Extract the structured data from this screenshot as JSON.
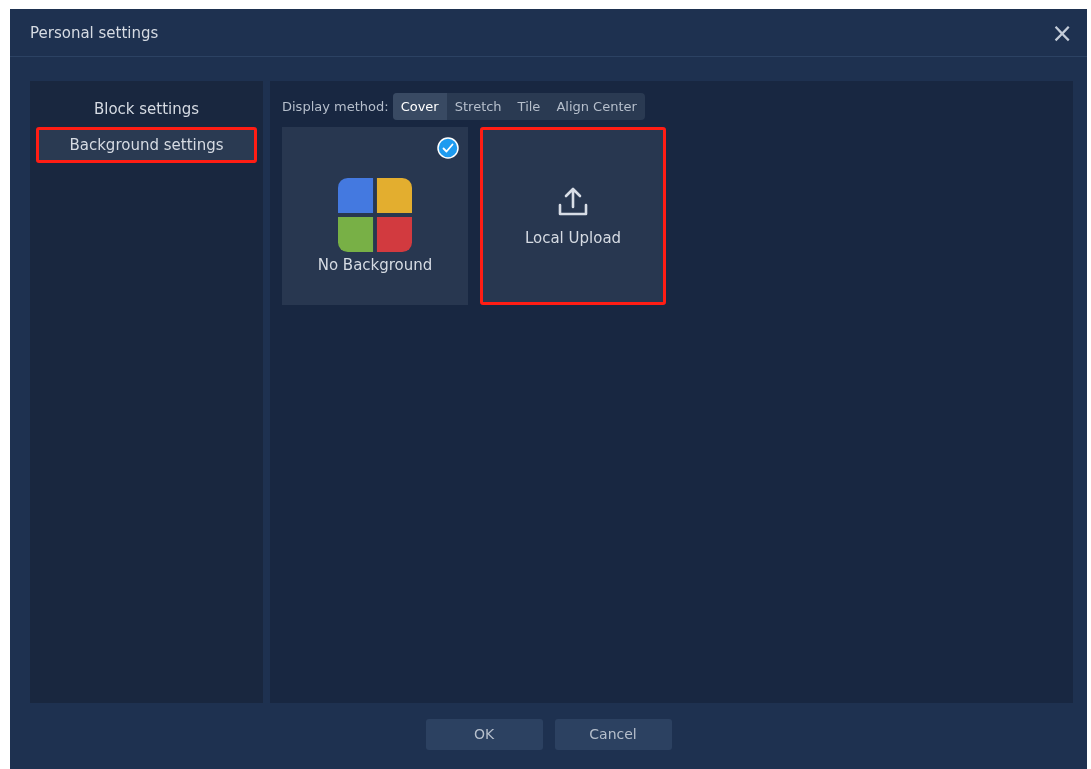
{
  "window": {
    "title": "Personal settings",
    "close": "×"
  },
  "sidebar": {
    "items": [
      {
        "label": "Block settings",
        "selected": false,
        "highlighted": false
      },
      {
        "label": "Background settings",
        "selected": true,
        "highlighted": true
      }
    ]
  },
  "display_method": {
    "label": "Display method:",
    "options": [
      {
        "label": "Cover",
        "selected": true
      },
      {
        "label": "Stretch",
        "selected": false
      },
      {
        "label": "Tile",
        "selected": false
      },
      {
        "label": "Align Center",
        "selected": false
      }
    ]
  },
  "tiles": [
    {
      "kind": "none",
      "label": "No Background",
      "selected": true,
      "highlighted": false
    },
    {
      "kind": "upload",
      "label": "Local Upload",
      "selected": false,
      "highlighted": true
    }
  ],
  "buttons": [
    "OK",
    "Cancel"
  ]
}
